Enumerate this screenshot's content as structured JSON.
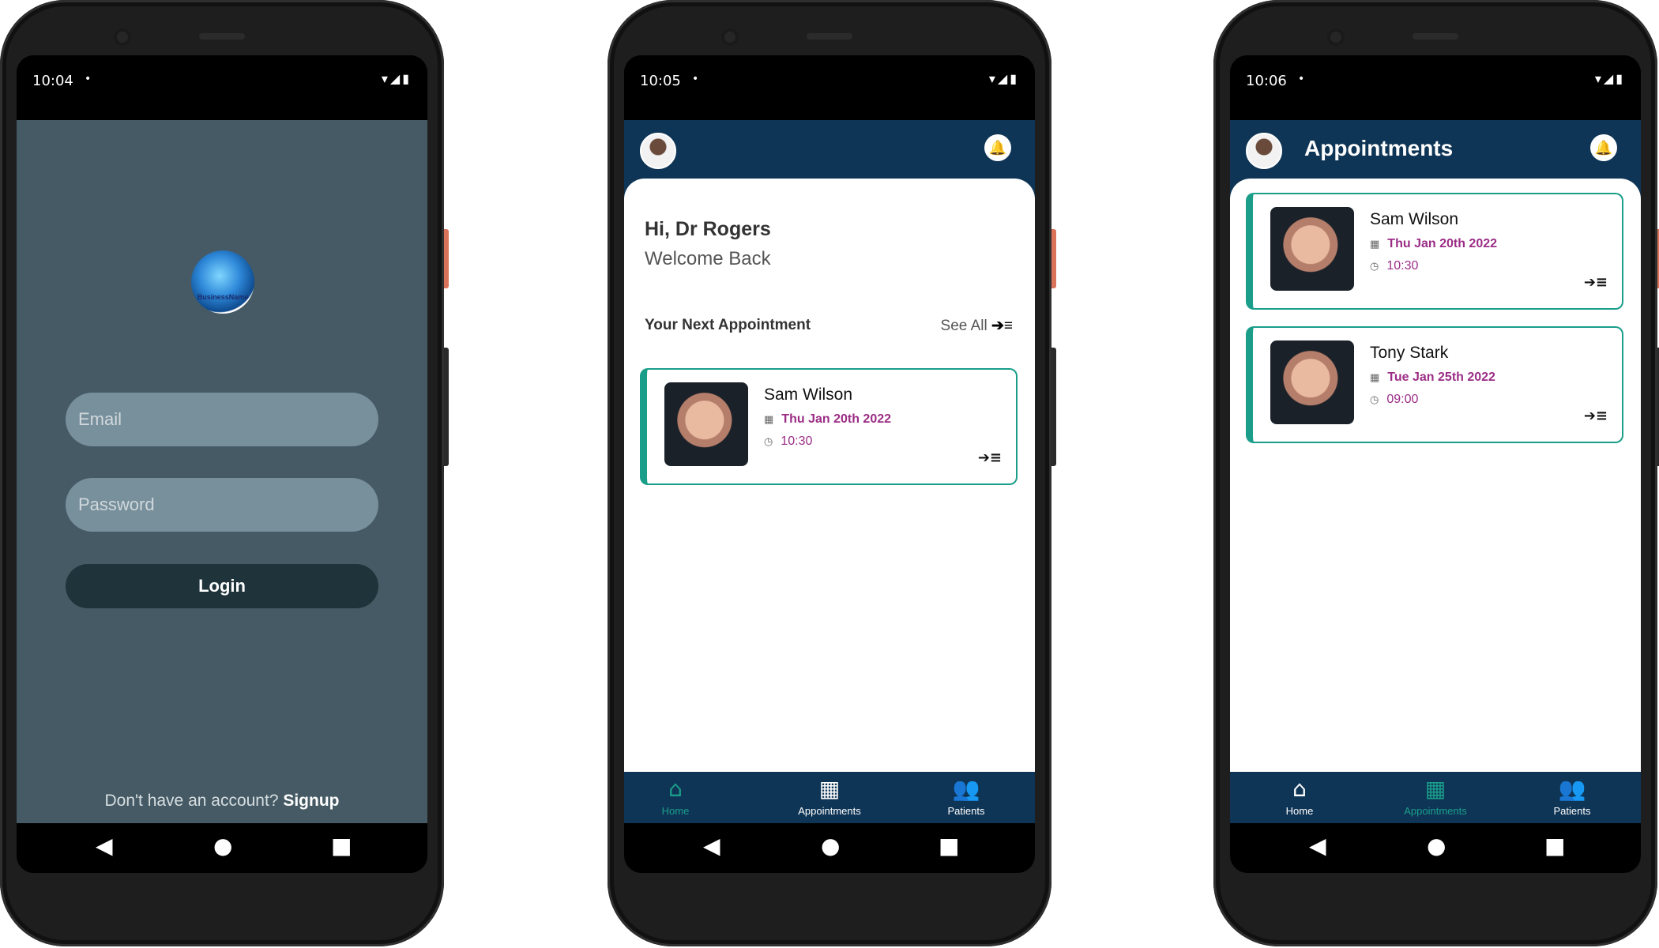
{
  "phones": [
    {
      "status": {
        "time": "10:04",
        "dot": "•",
        "icons": "▾◢▮"
      },
      "login": {
        "logo_text": "BusinessName",
        "email_placeholder": "Email",
        "password_placeholder": "Password",
        "login_label": "Login",
        "signup_prompt": "Don't have an account?",
        "signup_link": "Signup"
      }
    },
    {
      "status": {
        "time": "10:05",
        "dot": "•",
        "icons": "▾◢▮"
      },
      "home": {
        "greeting": "Hi, Dr Rogers",
        "welcome": "Welcome Back",
        "next_title": "Your Next Appointment",
        "see_all": "See All",
        "see_all_icon": "➔≡",
        "appointment": {
          "name": "Sam Wilson",
          "date": "Thu Jan 20th 2022",
          "time": "10:30"
        }
      },
      "tabs": [
        {
          "label": "Home",
          "icon": "⌂",
          "active": true
        },
        {
          "label": "Appointments",
          "icon": "▦",
          "active": false
        },
        {
          "label": "Patients",
          "icon": "👥",
          "active": false
        }
      ]
    },
    {
      "status": {
        "time": "10:06",
        "dot": "•",
        "icons": "▾◢▮"
      },
      "appointments": {
        "title": "Appointments",
        "items": [
          {
            "name": "Sam Wilson",
            "date": "Thu Jan 20th 2022",
            "time": "10:30"
          },
          {
            "name": "Tony Stark",
            "date": "Tue Jan 25th 2022",
            "time": "09:00"
          }
        ]
      },
      "tabs": [
        {
          "label": "Home",
          "icon": "⌂",
          "active": false
        },
        {
          "label": "Appointments",
          "icon": "▦",
          "active": true
        },
        {
          "label": "Patients",
          "icon": "👥",
          "active": false
        }
      ]
    }
  ],
  "nav": {
    "back": "◀",
    "home": "●",
    "recents": "■"
  },
  "icons": {
    "calendar": "▦",
    "clock": "◷",
    "arrow": "➔≡",
    "bell": "🔔"
  },
  "colors": {
    "navy": "#0f3556",
    "teal": "#1a9e8a",
    "magenta": "#9b2d86",
    "slate": "#455a64"
  }
}
